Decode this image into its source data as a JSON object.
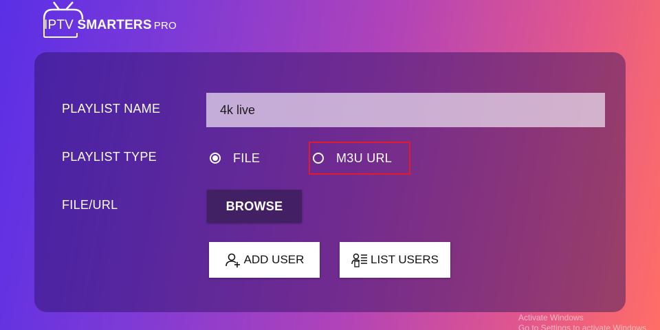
{
  "logo": {
    "iptv": "IPTV",
    "smarters": "SMARTERS",
    "pro": "PRO"
  },
  "form": {
    "playlist_name_label": "PLAYLIST NAME",
    "playlist_name_value": "4k live",
    "playlist_type_label": "PLAYLIST TYPE",
    "type_options": {
      "file": {
        "label": "FILE",
        "selected": true
      },
      "m3u": {
        "label": "M3U URL",
        "selected": false
      }
    },
    "file_url_label": "FILE/URL",
    "browse_label": "BROWSE"
  },
  "actions": {
    "add_user_label": "ADD USER",
    "list_users_label": "LIST USERS"
  },
  "watermark": {
    "line1": "Activate Windows",
    "line2": "Go to Settings to activate Windows."
  },
  "colors": {
    "highlight": "#e01c2a"
  }
}
